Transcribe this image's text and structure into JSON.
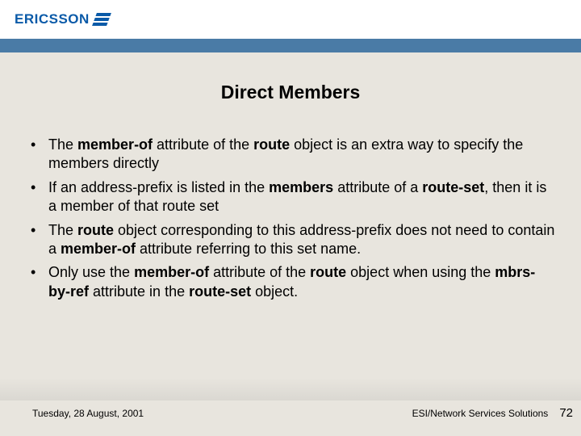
{
  "brand": {
    "name": "ERICSSON"
  },
  "title": "Direct Members",
  "bullets": [
    {
      "pre": "The ",
      "b1": "member-of",
      "mid1": " attribute of the ",
      "b2": "route",
      "post": " object is an extra way to specify the members directly"
    },
    {
      "pre": "If an address-prefix is listed in the ",
      "b1": "members",
      "mid1": " attribute of a ",
      "b2": "route-set",
      "post": ", then it is a member of that route set"
    },
    {
      "pre": "The ",
      "b1": "route",
      "mid1": " object corresponding to this address-prefix does not need to contain a ",
      "b2": "member-of",
      "post": " attribute referring to this set name."
    },
    {
      "pre": "Only use the ",
      "b1": "member-of",
      "mid1": " attribute of the ",
      "b2": "route",
      "mid2": " object when using the ",
      "b3": "mbrs-by-ref",
      "mid3": " attribute in the ",
      "b4": "route-set",
      "post": " object."
    }
  ],
  "footer": {
    "date": "Tuesday, 28 August, 2001",
    "org": "ESI/Network Services Solutions",
    "page": "72"
  }
}
